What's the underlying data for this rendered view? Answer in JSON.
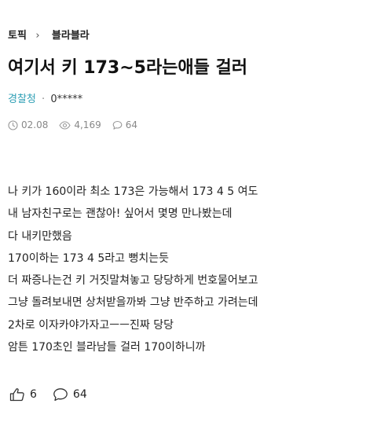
{
  "breadcrumb": {
    "topic_label": "토픽",
    "separator": "›",
    "board_label": "블라블라"
  },
  "post": {
    "title": "여기서 키 173~5라는애들 걸러",
    "author_org": "경찰청",
    "author_dot": "·",
    "author_name": "0*****",
    "date": "02.08",
    "views": "4,169",
    "comments": "64",
    "body_lines": [
      "나 키가 160이라 최소 173은 가능해서 173 4 5 여도",
      "내 남자친구로는 괜찮아! 싶어서 몇명 만나봤는데",
      "다 내키만했음",
      "170이하는 173 4 5라고 뻥치는듯",
      "더 짜증나는건 키 거짓말쳐놓고 당당하게 번호물어보고",
      "그냥 돌려보내면 상처받을까봐 그냥 반주하고 가려는데",
      "2차로 이자카야가자고ㅡㅡ진짜 당당",
      "암튼 170초인 블라남들 걸러 170이하니까"
    ]
  },
  "actions": {
    "likes": "6",
    "comments": "64"
  },
  "icons": {
    "date": "clock-icon",
    "views": "eye-icon",
    "comments": "speech-bubble-icon",
    "like": "thumbs-up-icon",
    "breadcrumb_sep": "chevron-right-icon"
  },
  "colors": {
    "author_org": "#2f9fb5",
    "meta_text": "#888888"
  }
}
